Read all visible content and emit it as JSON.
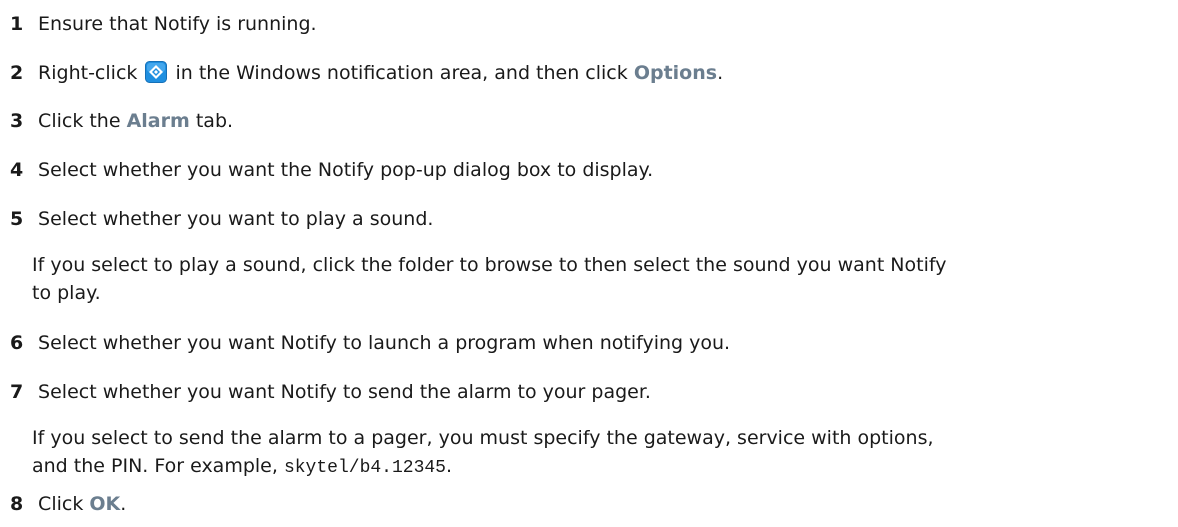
{
  "steps": [
    {
      "num": "1",
      "text": "Ensure that Notify is running."
    },
    {
      "num": "2",
      "pre": "Right-click",
      "post": "in the Windows notification area, and then click",
      "ui": "Options",
      "end": ".",
      "icon": "notify-tray-icon"
    },
    {
      "num": "3",
      "pre": "Click the",
      "ui": "Alarm",
      "post": "tab."
    },
    {
      "num": "4",
      "text": "Select whether you want the Notify pop-up dialog box to display."
    },
    {
      "num": "5",
      "text": "Select whether you want to play a sound."
    },
    {
      "num": "6",
      "text": "Select whether you want Notify to launch a program when notifying you."
    },
    {
      "num": "7",
      "text": "Select whether you want Notify to send the alarm to your pager."
    },
    {
      "num": "8",
      "pre": "Click",
      "ui": "OK",
      "end": "."
    }
  ],
  "notes": {
    "sound_line1": "If you select to play a sound, click the folder to browse to then select the sound you want Notify",
    "sound_line2": "to play.",
    "pager_line1": "If you select to send the alarm to a pager, you must specify the gateway, service with options,",
    "pager_line2_pre": "and the PIN. For example,",
    "pager_code": "skytel/b4.12345",
    "pager_line2_end": "."
  },
  "colors": {
    "ui_text": "#6b7e8f",
    "body_text": "#1a1a1a",
    "icon_blue": "#1f8fe0"
  }
}
